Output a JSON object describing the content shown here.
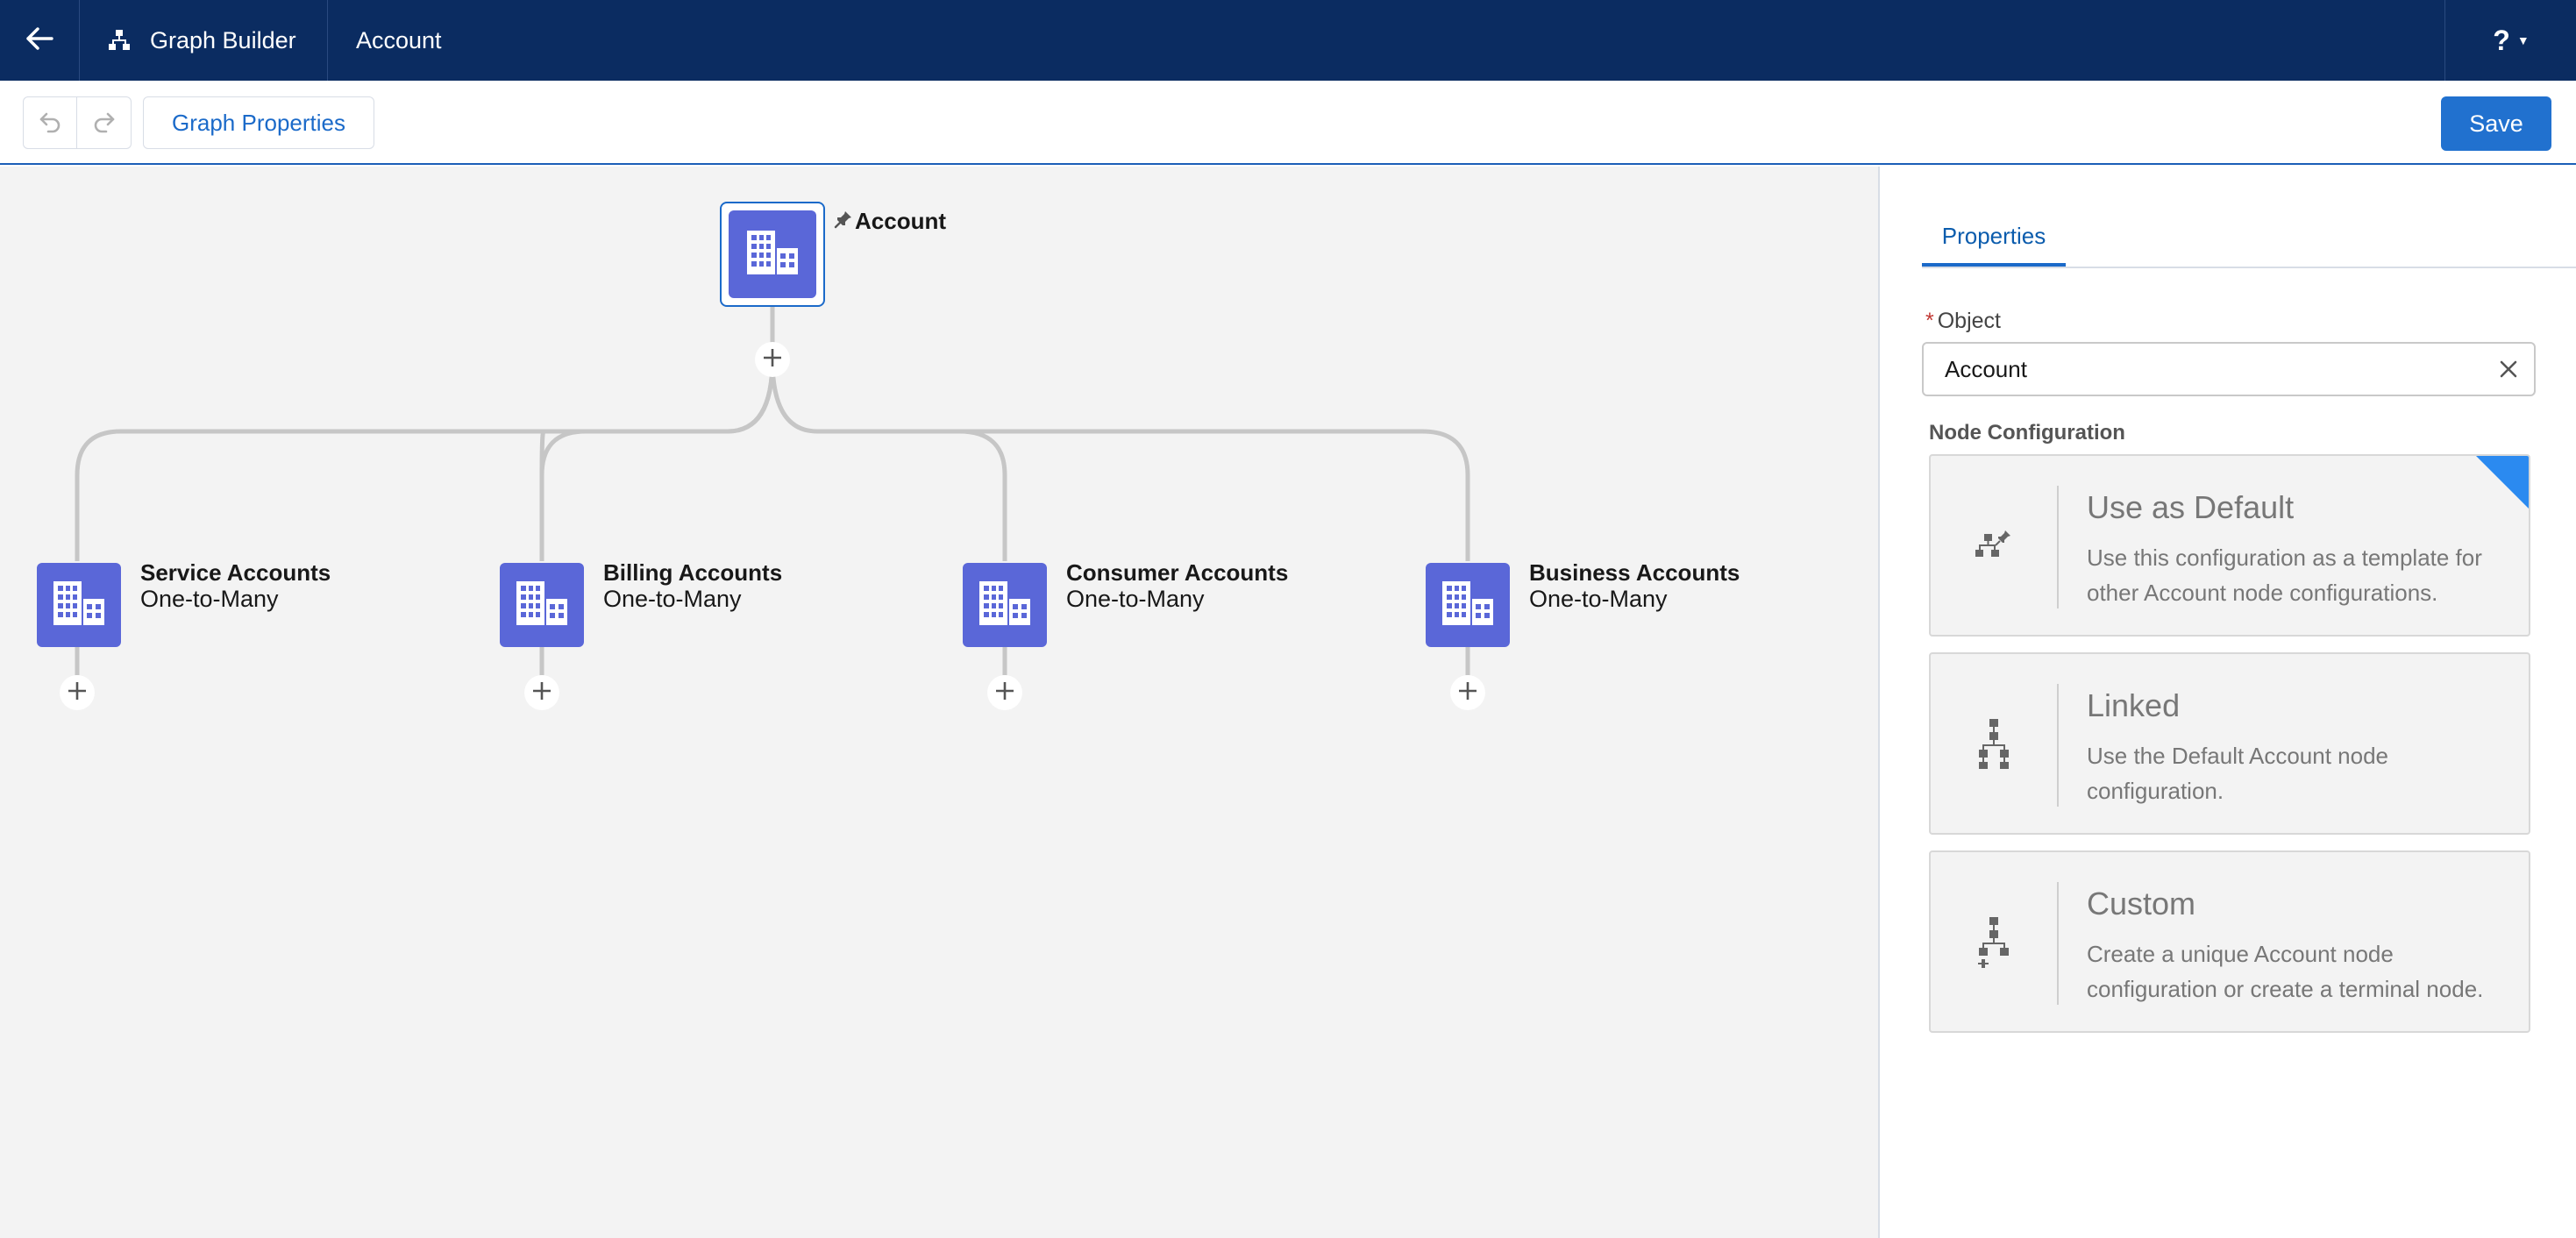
{
  "header": {
    "app_name": "Graph Builder",
    "record_name": "Account",
    "help_label": "?"
  },
  "toolbar": {
    "graph_properties_label": "Graph Properties",
    "save_label": "Save"
  },
  "graph": {
    "root": {
      "name": "Account"
    },
    "children": [
      {
        "name": "Service Accounts",
        "relationship": "One-to-Many"
      },
      {
        "name": "Billing Accounts",
        "relationship": "One-to-Many"
      },
      {
        "name": "Consumer Accounts",
        "relationship": "One-to-Many"
      },
      {
        "name": "Business Accounts",
        "relationship": "One-to-Many"
      }
    ]
  },
  "panel": {
    "tab_label": "Properties",
    "object_label": "Object",
    "object_required_marker": "*",
    "object_value": "Account",
    "node_config_label": "Node Configuration",
    "options": [
      {
        "title": "Use as Default",
        "description": "Use this configuration as a template for other Account node configurations.",
        "selected": true,
        "icon": "default-config-icon"
      },
      {
        "title": "Linked",
        "description": "Use the Default Account node configuration.",
        "selected": false,
        "icon": "linked-hierarchy-icon"
      },
      {
        "title": "Custom",
        "description": "Create a unique Account node configuration or create a terminal node.",
        "selected": false,
        "icon": "custom-hierarchy-icon"
      }
    ]
  },
  "colors": {
    "header_bg": "#0b2c61",
    "node_bg": "#5a67d8",
    "accent": "#2171cf",
    "selected_corner": "#2b8af0"
  }
}
